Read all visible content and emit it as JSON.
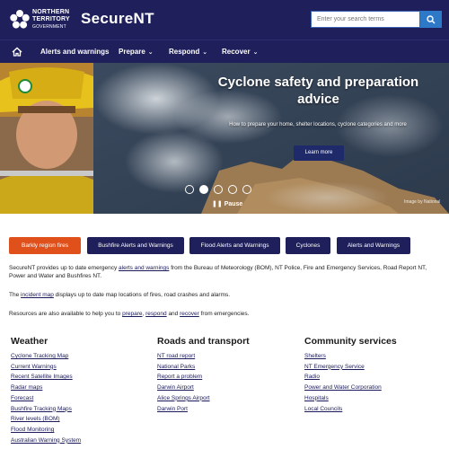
{
  "header": {
    "logo_line1": "NORTHERN",
    "logo_line2": "TERRITORY",
    "logo_line3": "GOVERNMENT",
    "site_title": "SecureNT",
    "search_placeholder": "Enter your search terms"
  },
  "nav": {
    "items": [
      {
        "label": "Alerts and warnings"
      },
      {
        "label": "Prepare"
      },
      {
        "label": "Respond"
      },
      {
        "label": "Recover"
      }
    ]
  },
  "hero": {
    "title": "Cyclone safety and preparation advice",
    "subtitle": "How to prepare your home, shelter locations, cyclone categories and more",
    "button_label": "Learn more",
    "pause_label": "Pause",
    "credit": "Image by National",
    "slides": 5,
    "active_slide": 2
  },
  "quick_links": [
    {
      "label": "Barkly region fires"
    },
    {
      "label": "Bushfire Alerts and Warnings"
    },
    {
      "label": "Flood Alerts and Warnings"
    },
    {
      "label": "Cyclones"
    },
    {
      "label": "Alerts and Warnings"
    }
  ],
  "intro": {
    "p1_pre": "SecureNT provides up to date emergency ",
    "p1_link": "alerts and warnings",
    "p1_post": " from the Bureau of Meteorology (BOM), NT Police, Fire and Emergency Services, Road Report NT, Power and Water and Bushfires NT.",
    "p2_pre": "The ",
    "p2_link": "incident map",
    "p2_post": " displays up to date map locations of fires, road crashes and alarms.",
    "p3_pre": "Resources are also available to help you to ",
    "p3_link1": "prepare",
    "p3_sep1": ", ",
    "p3_link2": "respond",
    "p3_sep2": " and ",
    "p3_link3": "recover",
    "p3_post": " from emergencies."
  },
  "columns": [
    {
      "title": "Weather",
      "links": [
        "Cyclone Tracking Map",
        "Current Warnings",
        "Recent Satellite Images",
        "Radar maps",
        "Forecast",
        "Bushfire Tracking Maps",
        "River levels (BOM)",
        "Flood Monitoring",
        "Australian Warning System"
      ]
    },
    {
      "title": "Roads and transport",
      "links": [
        "NT road report",
        "National Parks",
        "Report a problem",
        "Darwin Airport",
        "Alice Springs Airport",
        "Darwin Port"
      ]
    },
    {
      "title": "Community services",
      "links": [
        "Shelters",
        "NT Emergency Service",
        "Radio",
        "Power and Water Corporation",
        "Hospitals",
        "Local Councils"
      ]
    }
  ],
  "colors": {
    "navy": "#1f1f5c",
    "orange": "#e0501a",
    "search_blue": "#2e78c8"
  },
  "icons": {
    "home": "home-icon",
    "search": "search-icon",
    "logo": "nt-flower-logo"
  }
}
